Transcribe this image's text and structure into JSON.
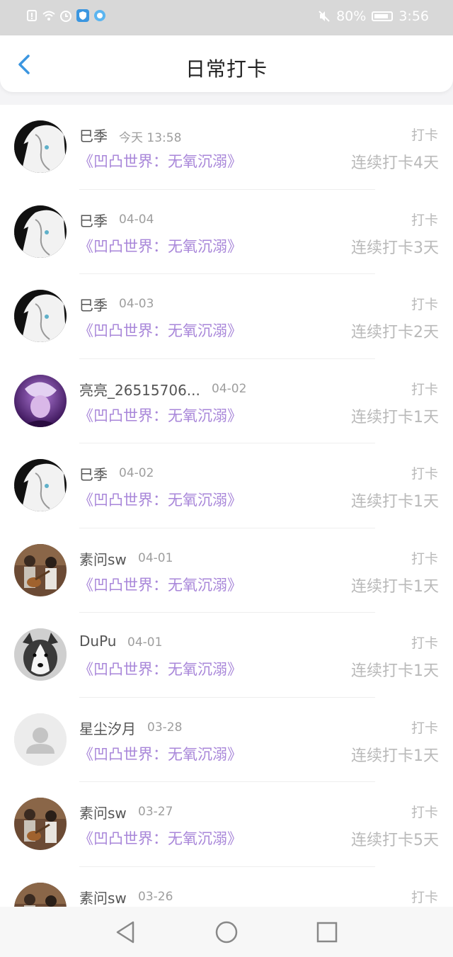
{
  "status_bar": {
    "battery": "80%",
    "time": "3:56"
  },
  "header": {
    "title": "日常打卡"
  },
  "colors": {
    "accent": "#3b96e0",
    "book_link": "#a886d9",
    "muted": "#b9b9b9"
  },
  "items": [
    {
      "name": "巳季",
      "time": "今天 13:58",
      "book": "《凹凸世界：无氧沉溺》",
      "label": "打卡",
      "streak": "连续打卡4天",
      "avatar": "anime-white"
    },
    {
      "name": "巳季",
      "time": "04-04",
      "book": "《凹凸世界：无氧沉溺》",
      "label": "打卡",
      "streak": "连续打卡3天",
      "avatar": "anime-white"
    },
    {
      "name": "巳季",
      "time": "04-03",
      "book": "《凹凸世界：无氧沉溺》",
      "label": "打卡",
      "streak": "连续打卡2天",
      "avatar": "anime-white"
    },
    {
      "name": "亮亮_26515706...",
      "time": "04-02",
      "book": "《凹凸世界：无氧沉溺》",
      "label": "打卡",
      "streak": "连续打卡1天",
      "avatar": "anime-purple"
    },
    {
      "name": "巳季",
      "time": "04-02",
      "book": "《凹凸世界：无氧沉溺》",
      "label": "打卡",
      "streak": "连续打卡1天",
      "avatar": "anime-white"
    },
    {
      "name": "素问sw",
      "time": "04-01",
      "book": "《凹凸世界：无氧沉溺》",
      "label": "打卡",
      "streak": "连续打卡1天",
      "avatar": "photo-guitar"
    },
    {
      "name": "DuPu",
      "time": "04-01",
      "book": "《凹凸世界：无氧沉溺》",
      "label": "打卡",
      "streak": "连续打卡1天",
      "avatar": "dog"
    },
    {
      "name": "星尘汐月",
      "time": "03-28",
      "book": "《凹凸世界：无氧沉溺》",
      "label": "打卡",
      "streak": "连续打卡1天",
      "avatar": "default"
    },
    {
      "name": "素问sw",
      "time": "03-27",
      "book": "《凹凸世界：无氧沉溺》",
      "label": "打卡",
      "streak": "连续打卡5天",
      "avatar": "photo-guitar"
    },
    {
      "name": "素问sw",
      "time": "03-26",
      "book": "",
      "label": "打卡",
      "streak": "",
      "avatar": "photo-guitar"
    }
  ]
}
